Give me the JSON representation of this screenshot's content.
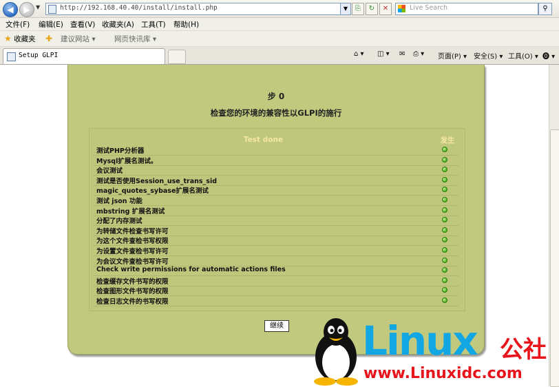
{
  "browser": {
    "url": "http://192.168.40.40/install/install.php",
    "search_placeholder": "Live Search",
    "menu": [
      {
        "label": "文件(F)"
      },
      {
        "label": "编辑(E)"
      },
      {
        "label": "查看(V)"
      },
      {
        "label": "收藏夹(A)"
      },
      {
        "label": "工具(T)"
      },
      {
        "label": "帮助(H)"
      }
    ],
    "favorites": {
      "label": "收藏夹",
      "links": [
        "建议网站 ▾",
        "网页快讯库 ▾"
      ]
    },
    "tab_title": "Setup GLPI",
    "commands": [
      "页面(P) ▾",
      "安全(S) ▾",
      "工具(O) ▾"
    ]
  },
  "page": {
    "step_title": "步 0",
    "heading": "检查您的环境的兼容性以GLPI的施行",
    "table": {
      "col_test": "Test done",
      "col_result": "发生",
      "rows": [
        {
          "label": "测试PHP分析器",
          "status": "ok"
        },
        {
          "label": "Mysql扩展名测试。",
          "status": "ok"
        },
        {
          "label": "会议测试",
          "status": "ok"
        },
        {
          "label": "测试是否使用Session_use_trans_sid",
          "status": "ok"
        },
        {
          "label": "magic_quotes_sybase扩展名测试",
          "status": "ok"
        },
        {
          "label": "测试 json 功能",
          "status": "ok"
        },
        {
          "label": "mbstring 扩展名测试",
          "status": "ok"
        },
        {
          "label": "分配了内存测试",
          "status": "ok"
        },
        {
          "label": "为转储文件检查书写许可",
          "status": "ok"
        },
        {
          "label": "为这个文件查检书写权限",
          "status": "ok"
        },
        {
          "label": "为设置文件查检书写许可",
          "status": "ok"
        },
        {
          "label": "为会议文件查检书写许可",
          "status": "ok"
        },
        {
          "label": "Check write permissions for automatic actions files",
          "status": "ok"
        },
        {
          "label": "检查缓存文件书写的权限",
          "status": "ok"
        },
        {
          "label": "检查图形文件书写的权限",
          "status": "ok"
        },
        {
          "label": "检查日志文件的书写权限",
          "status": "ok"
        }
      ]
    },
    "continue_label": "继续"
  },
  "watermark": {
    "brand": "Linux",
    "brand_cn": "公社",
    "url": "www.Linuxidc.com"
  },
  "colors": {
    "panel_bg": "#c0c97e",
    "header_text": "#f6e7a2",
    "ok_dot": "#4caf1d",
    "watermark_blue": "#12a7e3",
    "watermark_red": "#e8141b"
  }
}
